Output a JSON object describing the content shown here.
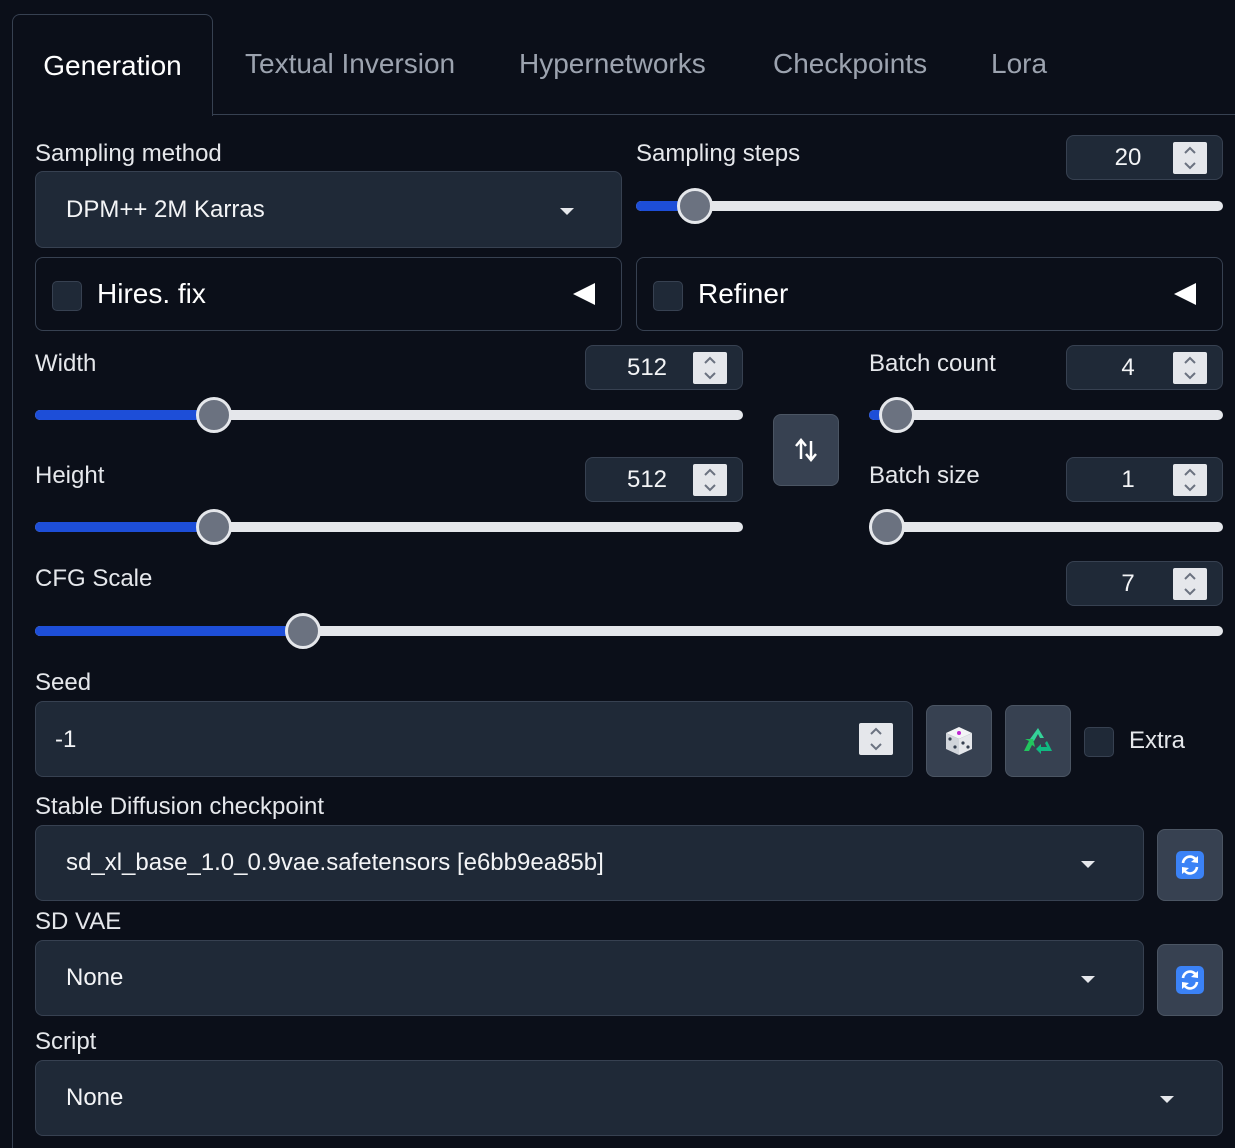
{
  "tabs": [
    {
      "label": "Generation",
      "active": true
    },
    {
      "label": "Textual Inversion",
      "active": false
    },
    {
      "label": "Hypernetworks",
      "active": false
    },
    {
      "label": "Checkpoints",
      "active": false
    },
    {
      "label": "Lora",
      "active": false
    }
  ],
  "sampling_method": {
    "label": "Sampling method",
    "value": "DPM++ 2M Karras"
  },
  "sampling_steps": {
    "label": "Sampling steps",
    "value": "20",
    "fraction": 0.075
  },
  "hires_fix": {
    "label": "Hires. fix",
    "checked": false
  },
  "refiner": {
    "label": "Refiner",
    "checked": false
  },
  "width": {
    "label": "Width",
    "value": "512",
    "fraction": 0.24
  },
  "height": {
    "label": "Height",
    "value": "512",
    "fraction": 0.24
  },
  "batch_count": {
    "label": "Batch count",
    "value": "4",
    "fraction": 0.03
  },
  "batch_size": {
    "label": "Batch size",
    "value": "1",
    "fraction": 0.0
  },
  "cfg_scale": {
    "label": "CFG Scale",
    "value": "7",
    "fraction": 0.217
  },
  "seed": {
    "label": "Seed",
    "value": "-1",
    "extra_label": "Extra",
    "extra_checked": false
  },
  "checkpoint": {
    "label": "Stable Diffusion checkpoint",
    "value": "sd_xl_base_1.0_0.9vae.safetensors [e6bb9ea85b]"
  },
  "sd_vae": {
    "label": "SD VAE",
    "value": "None"
  },
  "script": {
    "label": "Script",
    "value": "None"
  },
  "icons": {
    "swap": "swap-arrows-icon",
    "dice": "dice-icon",
    "recycle": "recycle-icon",
    "refresh": "refresh-icon"
  },
  "colors": {
    "accent": "#1d4ed8",
    "background": "#0b0f19",
    "panel": "#1f2937"
  }
}
